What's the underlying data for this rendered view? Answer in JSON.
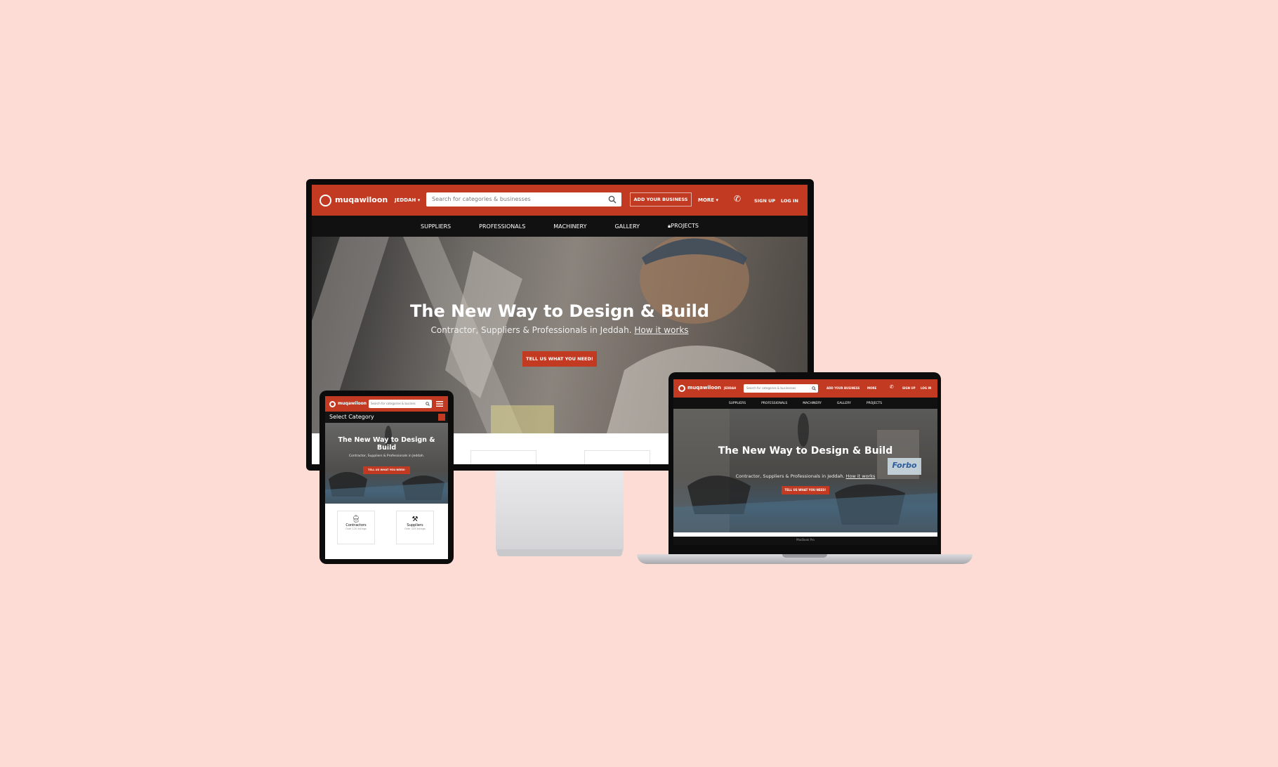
{
  "site": {
    "brand": "muqawiloon",
    "city": "JEDDAH",
    "search_placeholder": "Search for categories & businesses",
    "add_business": "ADD YOUR BUSINESS",
    "more": "MORE",
    "sign_up": "SIGN UP",
    "log_in": "LOG IN",
    "nav": [
      "SUPPLIERS",
      "PROFESSIONALS",
      "MACHINERY",
      "GALLERY",
      "PROJECTS"
    ],
    "hero_title": "The New Way to Design & Build",
    "hero_subtitle": "Contractor, Suppliers & Professionals in Jeddah.",
    "hero_link": "How it works",
    "cta": "TELL US WHAT YOU NEED!"
  },
  "tablet": {
    "search_placeholder": "Search for categories & busines",
    "select_category": "Select Category",
    "hero_title": "The New Way to Design & Build",
    "hero_subtitle": "Contractor, Suppliers & Professionals in Jeddah.",
    "cta": "TELL US WHAT YOU NEED!",
    "cards": [
      {
        "title": "Contractors",
        "sub": "Over 120 listings"
      },
      {
        "title": "Suppliers",
        "sub": "Over 325 listings"
      }
    ]
  },
  "laptop": {
    "model": "MacBook Pro",
    "watermark": "Forbo"
  },
  "colors": {
    "background": "#fddcd5",
    "brand_red": "#c23a22",
    "nav_black": "#111111"
  },
  "icons": [
    "logo-icon",
    "search-icon",
    "chevron-down-icon",
    "phone-icon",
    "lock-icon",
    "menu-icon",
    "worker-icon",
    "tools-icon"
  ]
}
